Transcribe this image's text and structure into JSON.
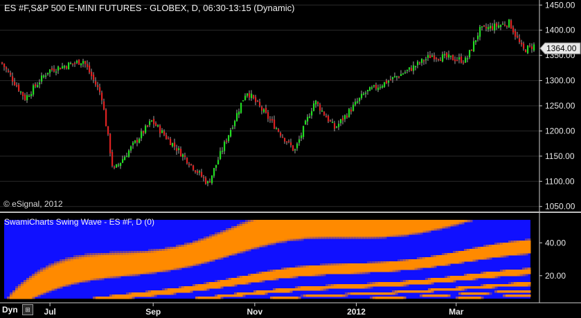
{
  "title": "ES #F,S&P 500 E-MINI FUTURES - GLOBEX, D, 06:30-13:15 (Dynamic)",
  "copyright": "© eSignal, 2012",
  "indicator_title": "SwamiCharts Swing Wave - ES #F, D (0)",
  "dyn_label": "Dyn",
  "dyn_icon": "zoom-icon",
  "colors": {
    "background": "#000000",
    "up": "#22dd22",
    "down": "#dd2222",
    "wave_high": "#ff8a00",
    "wave_low": "#1010ff",
    "grid": "#2a2a2a"
  },
  "chart_data": [
    {
      "type": "candlestick",
      "title": "ES #F,S&P 500 E-MINI FUTURES - GLOBEX, D, 06:30-13:15 (Dynamic)",
      "ylim": [
        1040,
        1460
      ],
      "y_ticks": [
        "1450.00",
        "1400.00",
        "1350.00",
        "1300.00",
        "1250.00",
        "1200.00",
        "1150.00",
        "1100.00",
        "1050.00"
      ],
      "last_price": "1364.00",
      "x_ticks": [
        "Jul",
        "Sep",
        "Nov",
        "2012",
        "Mar"
      ],
      "series": {
        "dates": [
          "2011-06-01",
          "2011-06-16",
          "2011-06-30",
          "2011-07-21",
          "2011-08-01",
          "2011-08-08",
          "2011-08-31",
          "2011-09-22",
          "2011-10-04",
          "2011-10-27",
          "2011-11-25",
          "2011-12-07",
          "2011-12-19",
          "2012-01-06",
          "2012-02-01",
          "2012-02-15",
          "2012-03-07",
          "2012-03-15",
          "2012-04-02",
          "2012-04-10",
          "2012-04-17"
        ],
        "close": [
          1340,
          1265,
          1320,
          1340,
          1270,
          1120,
          1220,
          1140,
          1095,
          1280,
          1160,
          1260,
          1205,
          1275,
          1320,
          1350,
          1340,
          1400,
          1415,
          1360,
          1370
        ]
      }
    },
    {
      "type": "heatmap",
      "title": "SwamiCharts Swing Wave - ES #F, D (0)",
      "ylim": [
        6,
        54
      ],
      "y_ticks": [
        "40.00",
        "20.00"
      ],
      "x_ticks": [
        "Jul",
        "Sep",
        "Nov",
        "2012",
        "Mar"
      ],
      "color_scale": [
        "#1010ff",
        "#ff8a00"
      ]
    }
  ]
}
